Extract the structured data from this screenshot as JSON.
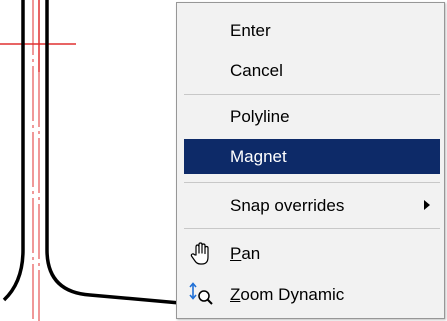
{
  "context_menu": {
    "items": [
      {
        "label": "Enter"
      },
      {
        "label": "Cancel"
      },
      {
        "label": "Polyline"
      },
      {
        "label": "Magnet",
        "selected": true
      },
      {
        "label": "Snap overrides",
        "submenu": true
      },
      {
        "label_accel": "P",
        "label_rest": "an",
        "icon": "pan-hand-icon"
      },
      {
        "label_accel": "Z",
        "label_rest": "oom Dynamic",
        "icon": "zoom-dynamic-icon"
      }
    ]
  },
  "colors": {
    "menu_background": "#f2f2f2",
    "selection": "#0d2a68",
    "crosshair": "#e03030",
    "geometry": "#000000"
  }
}
